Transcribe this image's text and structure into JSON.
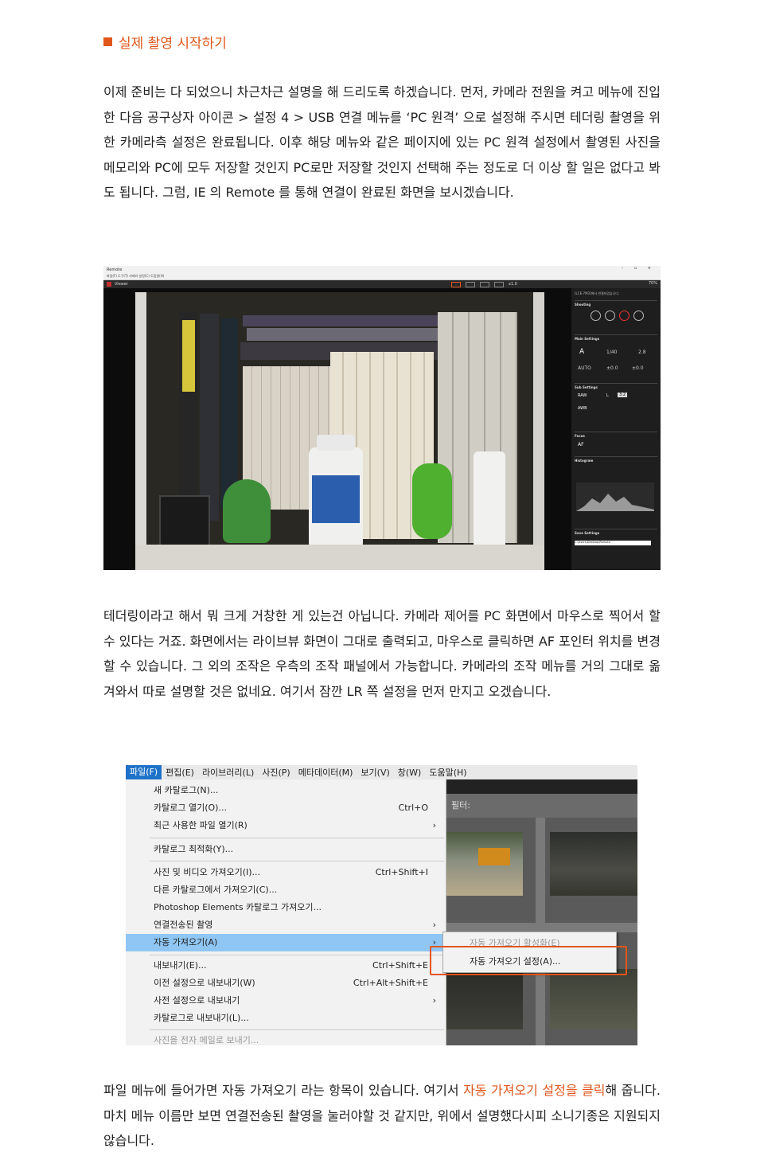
{
  "heading": "실제 촬영 시작하기",
  "para1": "이제 준비는 다 되었으니 차근차근 설명을 해 드리도록 하겠습니다. 먼저, 카메라 전원을 켜고 메뉴에 진입한 다음 공구상자 아이콘 > 설정 4 > USB 연결 메뉴를 ‘PC 원격’ 으로 설정해 주시면 테더링 촬영을 위한 카메라측 설정은 완료됩니다. 이후 해당 메뉴와 같은 페이지에 있는 PC 원격 설정에서 촬영된 사진을 메모리와 PC에 모두 저장할 것인지 PC로만 저장할 것인지 선택해 주는 정도로 더 이상 할 일은 없다고 봐도 됩니다. 그럼, IE 의 Remote 를 통해 연결이 완료된 화면을 보시겠습니다.",
  "para2": "테더링이라고 해서 뭐 크게 거창한 게 있는건 아닙니다. 카메라 제어를 PC 화면에서 마우스로 찍어서 할 수 있다는 거죠. 화면에서는 라이브뷰 화면이 그대로 출력되고, 마우스로 클릭하면 AF 포인터 위치를 변경할 수 있습니다. 그 외의 조작은 우측의 조작 패널에서 가능합니다. 카메라의 조작 메뉴를 거의 그대로 옮겨와서 따로 설명할 것은 없네요. 여기서 잠깐 LR 쪽 설정을 먼저 만지고 오겠습니다.",
  "para3": {
    "before": "파일 메뉴에 들어가면 자동 가져오기 라는 항목이 있습니다. 여기서 ",
    "highlight": "자동 가져오기 설정을 클릭",
    "after": "해 줍니다. 마치 메뉴 이름만 보면 연결전송된 촬영을 눌러야할 것 같지만, 위에서 설명했다시피 소니기종은 지원되지 않습니다."
  },
  "remote": {
    "title": "Remote",
    "menu": "파일(F)  도구(T)  카메라 설정(C)  도움말(H)",
    "viewer": "Viewer",
    "zoom": "x1.0",
    "battery": "70%",
    "panel": {
      "path": "[LCE-7M3]에서 연결되었습니다.",
      "shooting": "Shooting",
      "main": "Main Settings",
      "mode": "A",
      "shutter": "1/40",
      "fnum": "2.8",
      "iso": "AUTO",
      "ev": "±0.0",
      "flash": "±0.0",
      "sub": "Sub Settings",
      "raw": "RAW",
      "size": "L",
      "aspect": "3:2",
      "awb": "AWB",
      "focus": "Focus",
      "af": "AF",
      "histogram": "Histogram",
      "save": "Save Settings",
      "savepath": "C:\\Users\\Desktop\\Remote"
    }
  },
  "lightroom": {
    "menubar": [
      "파일(F)",
      "편집(E)",
      "라이브러리(L)",
      "사진(P)",
      "메타데이터(M)",
      "보기(V)",
      "창(W)",
      "도움말(H)"
    ],
    "filter": "필터:",
    "items": [
      {
        "label": "새 카탈로그(N)...",
        "shortcut": ""
      },
      {
        "label": "카탈로그 열기(O)...",
        "shortcut": "Ctrl+O"
      },
      {
        "label": "최근 사용한 파일 열기(R)",
        "shortcut": "›"
      },
      {
        "label": "카탈로그 최적화(Y)...",
        "shortcut": ""
      },
      {
        "label": "사진 및 비디오 가져오기(I)...",
        "shortcut": "Ctrl+Shift+I"
      },
      {
        "label": "다른 카탈로그에서 가져오기(C)...",
        "shortcut": ""
      },
      {
        "label": "Photoshop Elements 카탈로그 가져오기...",
        "shortcut": ""
      },
      {
        "label": "연결전송된 촬영",
        "shortcut": "›"
      },
      {
        "label": "자동 가져오기(A)",
        "shortcut": "›"
      },
      {
        "label": "내보내기(E)...",
        "shortcut": "Ctrl+Shift+E"
      },
      {
        "label": "이전 설정으로 내보내기(W)",
        "shortcut": "Ctrl+Alt+Shift+E"
      },
      {
        "label": "사전 설정으로 내보내기",
        "shortcut": "›"
      },
      {
        "label": "카탈로그로 내보내기(L)...",
        "shortcut": ""
      },
      {
        "label": "사진을 전자 메일로 보내기...",
        "shortcut": ""
      }
    ],
    "submenu": [
      "자동 가져오기 활성화(E)",
      "자동 가져오기 설정(A)..."
    ]
  },
  "colors": {
    "accent": "#e0561b",
    "menu_selected": "#8fc6f4",
    "menubar_active": "#1e73c9"
  }
}
